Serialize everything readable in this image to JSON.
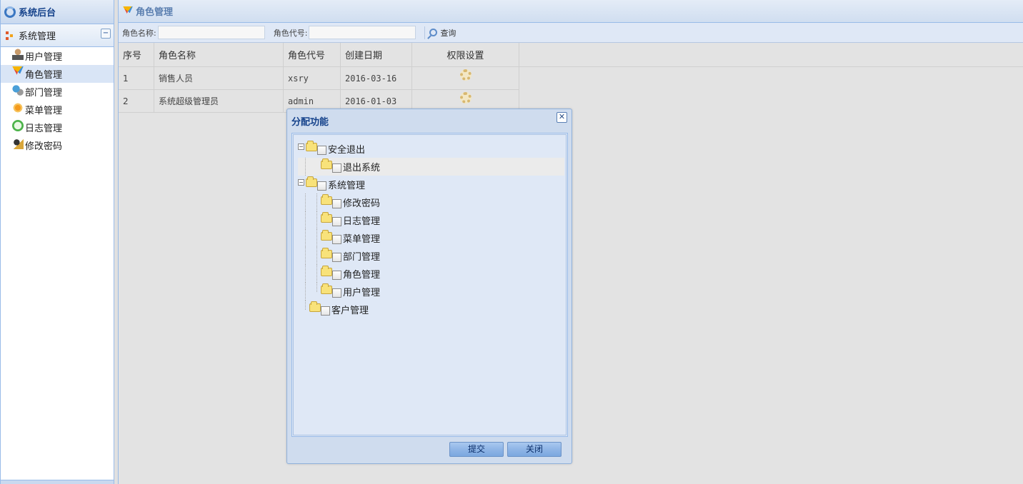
{
  "app": {
    "title": "系统后台"
  },
  "sidebar": {
    "panel_title": "系统管理",
    "collapse_label": "−",
    "items": [
      {
        "label": "用户管理",
        "icon": "user-icon",
        "active": false
      },
      {
        "label": "角色管理",
        "icon": "role-icon",
        "active": true
      },
      {
        "label": "部门管理",
        "icon": "department-icon",
        "active": false
      },
      {
        "label": "菜单管理",
        "icon": "menu-icon",
        "active": false
      },
      {
        "label": "日志管理",
        "icon": "log-icon",
        "active": false
      },
      {
        "label": "修改密码",
        "icon": "password-icon",
        "active": false
      }
    ]
  },
  "main": {
    "title": "角色管理",
    "toolbar": {
      "role_name_label": "角色名称:",
      "role_name_value": "",
      "role_code_label": "角色代号:",
      "role_code_value": "",
      "search_label": "查询"
    },
    "grid": {
      "columns": [
        "序号",
        "角色名称",
        "角色代号",
        "创建日期",
        "权限设置"
      ],
      "rows": [
        {
          "index": "1",
          "name": "销售人员",
          "code": "xsry",
          "date": "2016-03-16"
        },
        {
          "index": "2",
          "name": "系统超级管理员",
          "code": "admin",
          "date": "2016-01-03"
        }
      ]
    }
  },
  "dialog": {
    "title": "分配功能",
    "close_label": "✕",
    "tree": [
      {
        "label": "安全退出",
        "toggle": "−"
      },
      {
        "label": "退出系统"
      },
      {
        "label": "系统管理",
        "toggle": "−"
      },
      {
        "label": "修改密码"
      },
      {
        "label": "日志管理"
      },
      {
        "label": "菜单管理"
      },
      {
        "label": "部门管理"
      },
      {
        "label": "角色管理"
      },
      {
        "label": "用户管理"
      },
      {
        "label": "客户管理"
      }
    ],
    "submit_label": "提交",
    "cancel_label": "关闭"
  },
  "colors": {
    "accent": "#15428b",
    "border": "#99bbe8",
    "panel": "#dfe8f6"
  }
}
